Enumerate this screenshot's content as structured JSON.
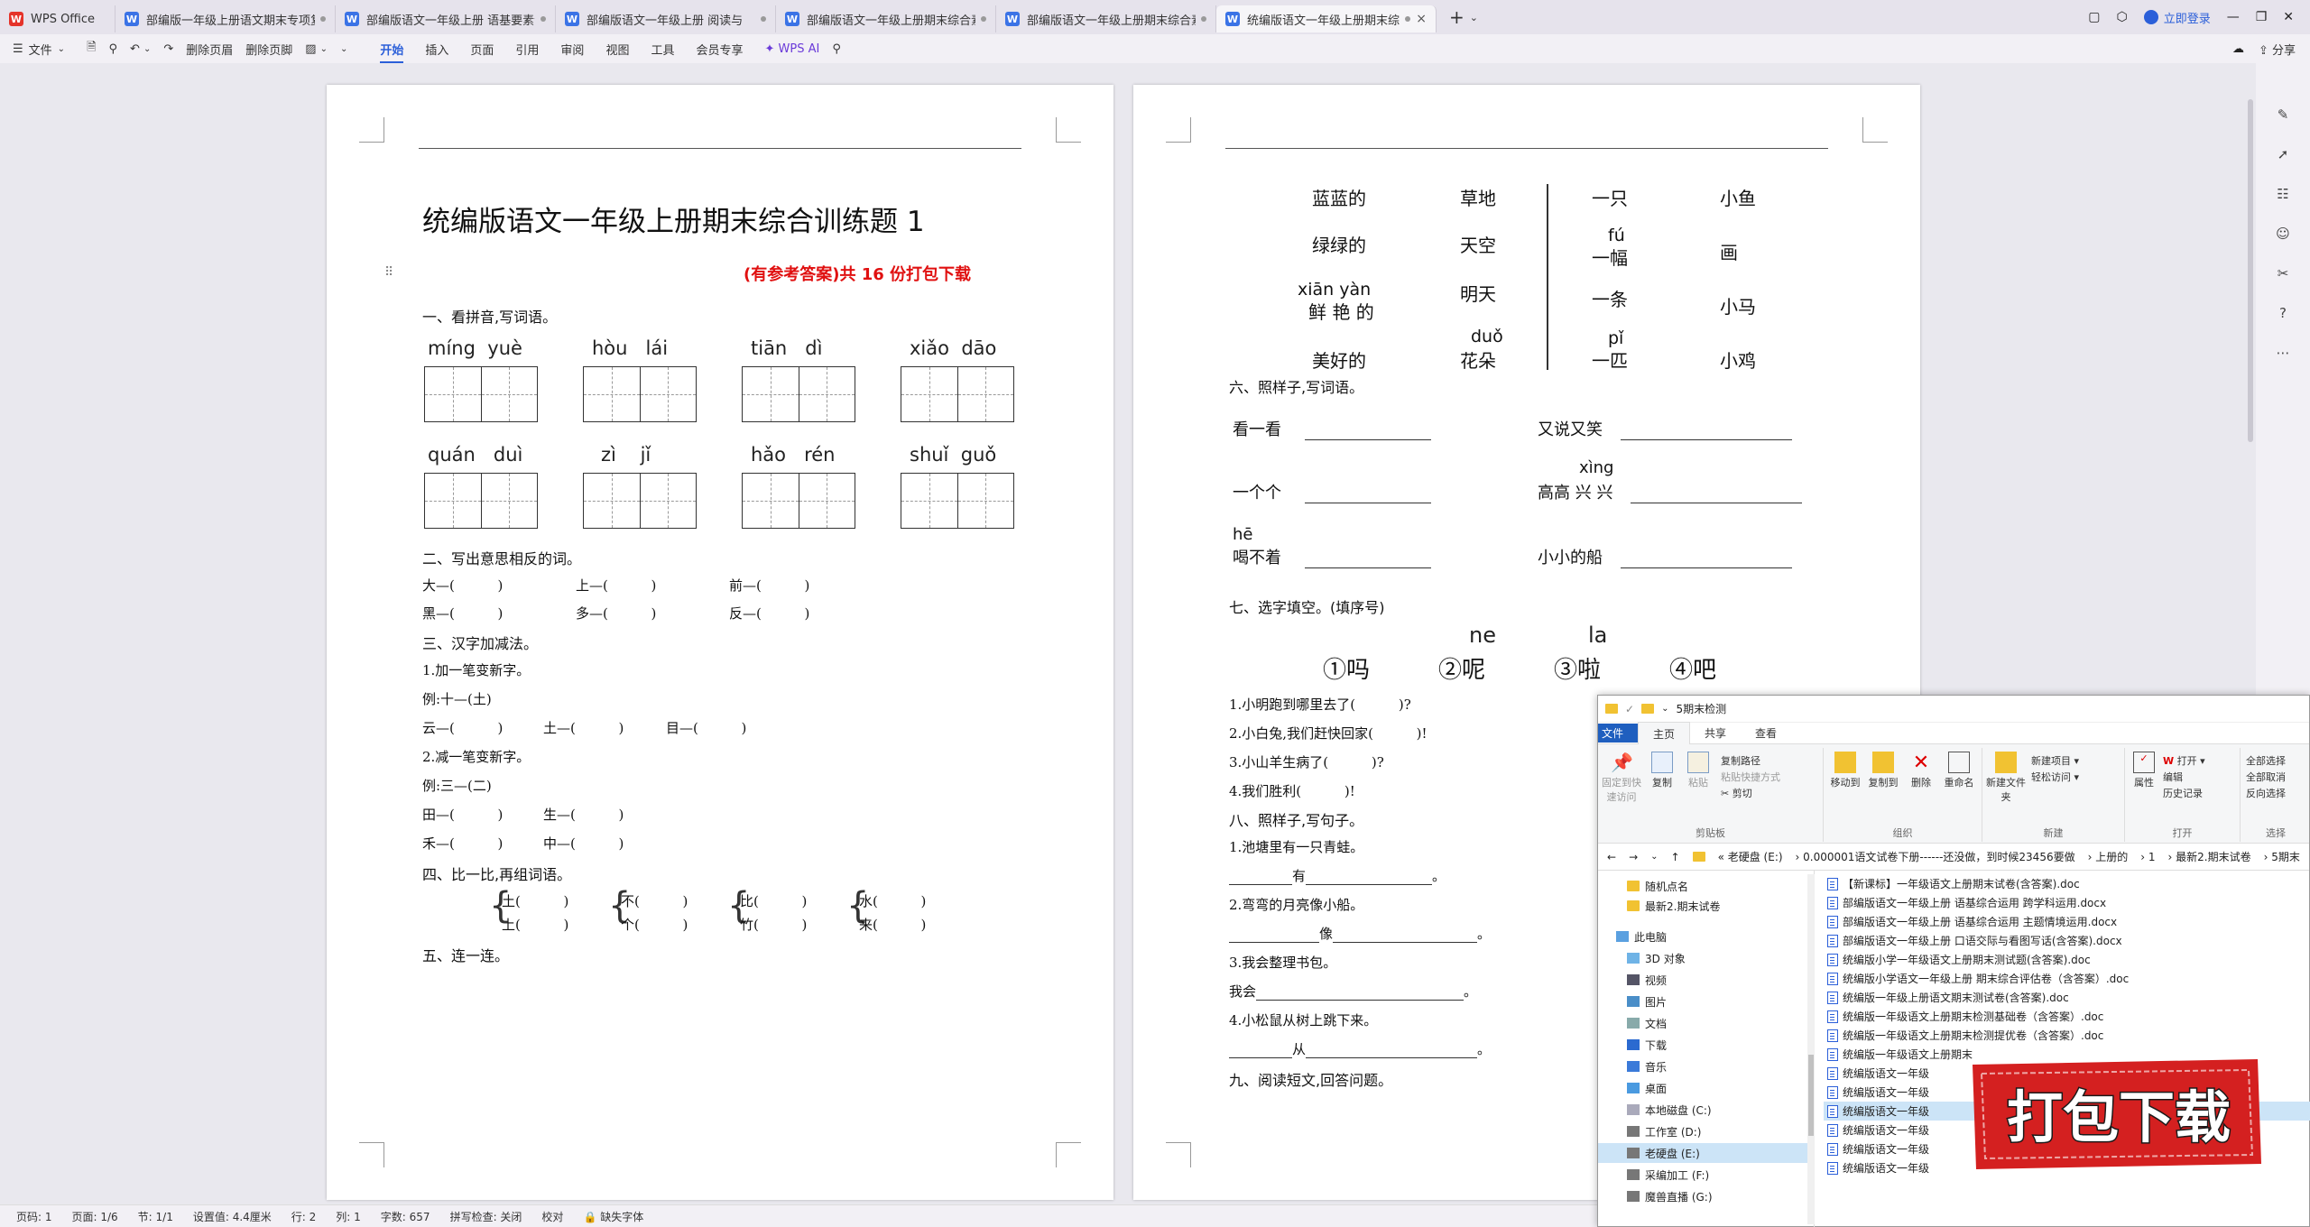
{
  "tabs": [
    {
      "label": "WPS Office",
      "kind": "wps"
    },
    {
      "label": "部编版一年级上册语文期末专项复",
      "kind": "w"
    },
    {
      "label": "部编版语文一年级上册 语基要素专",
      "kind": "w"
    },
    {
      "label": "部编版语文一年级上册   阅读与",
      "kind": "w"
    },
    {
      "label": "部编版语文一年级上册期末综合素质",
      "kind": "w"
    },
    {
      "label": "部编版语文一年级上册期末综合素",
      "kind": "w"
    },
    {
      "label": "统编版语文一年级上册期末综",
      "kind": "w"
    }
  ],
  "titlebar": {
    "login": "立即登录"
  },
  "ribbon": {
    "file_menu": "文件",
    "del_header": "删除页眉",
    "del_footer": "删除页脚",
    "tabs": [
      "开始",
      "插入",
      "页面",
      "引用",
      "审阅",
      "视图",
      "工具",
      "会员专享"
    ],
    "ai": "WPS AI",
    "share": "分享"
  },
  "doc": {
    "title": "统编版语文一年级上册期末综合训练题 1",
    "promo": "(有参考答案)共 16 份打包下载",
    "s1": "一、看拼音,写词语。",
    "pinyin_row1": [
      [
        "míng",
        "yuè"
      ],
      [
        "hòu",
        "lái"
      ],
      [
        "tiān",
        "dì"
      ],
      [
        "xiǎo",
        "dāo"
      ]
    ],
    "pinyin_row2": [
      [
        "quán",
        "duì"
      ],
      [
        "zì",
        "jǐ"
      ],
      [
        "hǎo",
        "rén"
      ],
      [
        "shuǐ",
        "guǒ"
      ]
    ],
    "s2": "二、写出意思相反的词。",
    "opp1": "大—(          )",
    "opp2": "上—(          )",
    "opp3": "前—(          )",
    "opp4": "黑—(          )",
    "opp5": "多—(          )",
    "opp6": "反—(          )",
    "s3": "三、汉字加减法。",
    "s3_1": "1.加一笔变新字。",
    "s3_ex1": "例:十—(土)",
    "s3_a": "云—(          )",
    "s3_b": "土—(          )",
    "s3_c": "目—(          )",
    "s3_2": "2.减一笔变新字。",
    "s3_ex2": "例:三—(二)",
    "s3_d": "田—(          )",
    "s3_e": "生—(          )",
    "s3_f": "禾—(          )",
    "s3_g": "中—(          )",
    "s4": "四、比一比,再组词语。",
    "cmp": [
      [
        "土(          )",
        "上(          )"
      ],
      [
        "不(          )",
        "个(          )"
      ],
      [
        "比(          )",
        "竹(          )"
      ],
      [
        "水(          )",
        "来(          )"
      ]
    ],
    "s5": "五、连一连。",
    "link_left": [
      [
        "蓝蓝的",
        "草地"
      ],
      [
        "绿绿的",
        "天空"
      ],
      [
        "鲜 艳 的",
        "明天"
      ],
      [
        "美好的",
        "花朵"
      ]
    ],
    "link_left_py": [
      "xiān yàn",
      "duǒ"
    ],
    "link_right": [
      [
        "一只",
        "小鱼"
      ],
      [
        "一幅",
        "画"
      ],
      [
        "一条",
        "小马"
      ],
      [
        "一匹",
        "小鸡"
      ]
    ],
    "link_right_py": [
      "fú",
      "pǐ"
    ],
    "s6": "六、照样子,写词语。",
    "s6_items": [
      "看一看",
      "又说又笑",
      "一个个",
      "高高 兴 兴",
      "喝不着",
      "小小的船"
    ],
    "s6_py": [
      "xìng",
      "hē"
    ],
    "s7": "七、选字填空。(填序号)",
    "s7_py": [
      "ne",
      "la"
    ],
    "s7_opts": [
      "①吗",
      "②呢",
      "③啦",
      "④吧"
    ],
    "s7_q": [
      "1.小明跑到哪里去了(          )?",
      "2.小白兔,我们赶快回家(          )!",
      "3.小山羊生病了(          )?",
      "4.我们胜利(          )!"
    ],
    "s8": "八、照样子,写句子。",
    "s8_1": "1.池塘里有一只青蛙。",
    "s8_1a": "有",
    "s8_2": "2.弯弯的月亮像小船。",
    "s8_2a": "像",
    "s8_3": "3.我会整理书包。",
    "s8_3a": "我会",
    "s8_4": "4.小松鼠从树上跳下来。",
    "s8_4a": "从",
    "s9": "九、阅读短文,回答问题。"
  },
  "status": {
    "page": "页码: 1",
    "pages": "页面: 1/6",
    "section": "节: 1/1",
    "setting": "设置值: 4.4厘米",
    "row": "行: 2",
    "col": "列: 1",
    "words": "字数: 657",
    "spell": "拼写检查: 关闭",
    "proof": "校对",
    "missing_font": "缺失字体"
  },
  "explorer": {
    "title": "5期末检测",
    "tabs": [
      "文件",
      "主页",
      "共享",
      "查看"
    ],
    "ribbon": {
      "pin": "固定到快速访问",
      "copy": "复制",
      "paste": "粘贴",
      "copy_path": "复制路径",
      "paste_shortcut": "粘贴快捷方式",
      "cut": "剪切",
      "clipboard": "剪贴板",
      "move_to": "移动到",
      "copy_to": "复制到",
      "delete": "删除",
      "rename": "重命名",
      "organize": "组织",
      "new_folder": "新建文件夹",
      "new_item": "新建项目",
      "easy_access": "轻松访问",
      "new": "新建",
      "properties": "属性",
      "open": "打开",
      "edit": "编辑",
      "history": "历史记录",
      "open_grp": "打开",
      "select_all": "全部选择",
      "select_none": "全部取消",
      "invert": "反向选择",
      "select_grp": "选择"
    },
    "address": [
      "老硬盘 (E:)",
      "0.000001语文试卷下册------还没做，到时候23456要做",
      "上册的",
      "1",
      "最新2.期末试卷",
      "5期末"
    ],
    "nav": [
      "随机点名",
      "最新2.期末试卷",
      "此电脑",
      "3D 对象",
      "视频",
      "图片",
      "文档",
      "下载",
      "音乐",
      "桌面",
      "本地磁盘 (C:)",
      "工作室 (D:)",
      "老硬盘 (E:)",
      "采编加工 (F:)",
      "魔兽直播 (G:)"
    ],
    "files": [
      "【新课标】一年级语文上册期末试卷(含答案).doc",
      "部编版语文一年级上册  语基综合运用 跨学科运用.docx",
      "部编版语文一年级上册  语基综合运用 主题情境运用.docx",
      "部编版语文一年级上册 口语交际与看图写话(含答案).docx",
      "统编版小学一年级语文上册期末测试题(含答案).doc",
      "统编版小学语文一年级上册 期末综合评估卷（含答案）.doc",
      "统编版一年级上册语文期末测试卷(含答案).doc",
      "统编版一年级语文上册期末检测基础卷（含答案）.doc",
      "统编版一年级语文上册期末检测提优卷（含答案）.doc",
      "统编版一年级语文上册期末",
      "统编版语文一年级",
      "统编版语文一年级",
      "统编版语文一年级",
      "统编版语文一年级",
      "统编版语文一年级",
      "统编版语文一年级"
    ]
  },
  "stamp": {
    "text": "打包下载",
    "color": "#d42020"
  },
  "colors": {
    "accent": "#2b5fd9",
    "promo": "#e01010"
  }
}
